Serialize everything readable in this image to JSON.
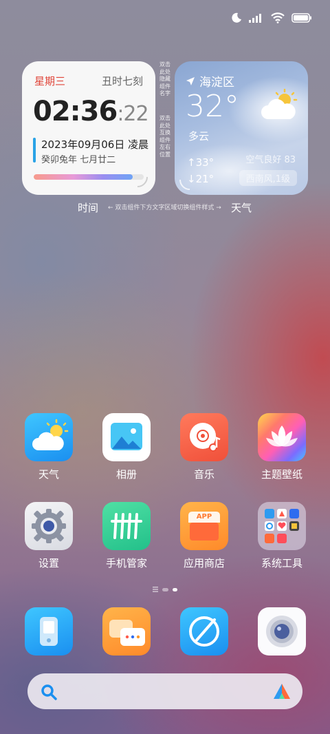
{
  "status_bar": {
    "icons": [
      "moon-icon",
      "signal-icon",
      "wifi-icon",
      "battery-icon"
    ]
  },
  "time_widget": {
    "weekday": "星期三",
    "shichen": "丑时七刻",
    "time_main": "02:36",
    "time_seconds": ":22",
    "date": "2023年09月06日 凌晨",
    "lunar": "癸卯兔年 七月廿二",
    "day_progress": 0.9,
    "label": "时间"
  },
  "hints": {
    "left_vertical": "双击此处隐藏组件名字",
    "right_vertical": "双击此处互换组件左右位置",
    "switch_style": "← 双击组件下方文字区域切换组件样式 →"
  },
  "weather_widget": {
    "location": "海淀区",
    "temperature": "32°",
    "condition": "多云",
    "high": "33°",
    "low": "21°",
    "air_quality": "空气良好 83",
    "wind": "西南风,1级",
    "label": "天气"
  },
  "apps_row1": [
    {
      "label": "天气",
      "icon": "weather-icon"
    },
    {
      "label": "相册",
      "icon": "gallery-icon"
    },
    {
      "label": "音乐",
      "icon": "music-icon"
    },
    {
      "label": "主题壁纸",
      "icon": "themes-icon"
    }
  ],
  "apps_row2": [
    {
      "label": "设置",
      "icon": "settings-icon"
    },
    {
      "label": "手机管家",
      "icon": "security-icon"
    },
    {
      "label": "应用商店",
      "icon": "app-store-icon"
    },
    {
      "label": "系统工具",
      "icon": "folder-icon"
    }
  ],
  "app_store_badge": "APP",
  "dock": [
    {
      "icon": "phone-icon"
    },
    {
      "icon": "messages-icon"
    },
    {
      "icon": "browser-icon"
    },
    {
      "icon": "camera-icon"
    }
  ],
  "page_indicator": {
    "pages": 2,
    "current": 1
  },
  "colors": {
    "weekday": "#e0463a",
    "accent_bar": "#2aa3e6"
  }
}
